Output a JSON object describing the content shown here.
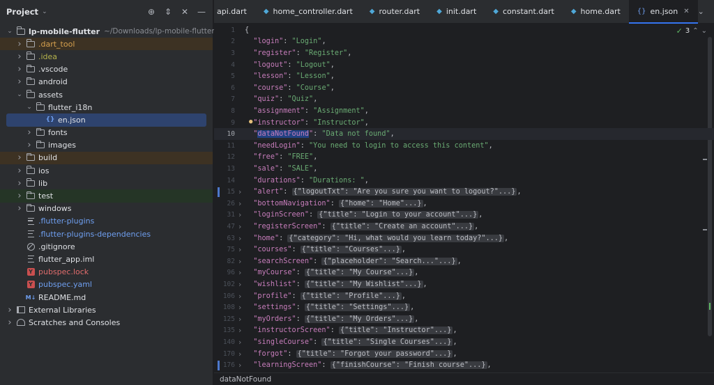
{
  "project_panel": {
    "title": "Project",
    "tree": [
      {
        "label": "lp-mobile-flutter",
        "path": "~/Downloads/lp-mobile-flutter",
        "indent": 0,
        "arrow": "open",
        "icon": "folder",
        "style": "bold"
      },
      {
        "label": ".dart_tool",
        "indent": 1,
        "arrow": "closed",
        "icon": "folder",
        "style": "orange",
        "hl": "excluded"
      },
      {
        "label": ".idea",
        "indent": 1,
        "arrow": "closed",
        "icon": "folder",
        "style": "yellow-green"
      },
      {
        "label": ".vscode",
        "indent": 1,
        "arrow": "closed",
        "icon": "folder",
        "style": ""
      },
      {
        "label": "android",
        "indent": 1,
        "arrow": "closed",
        "icon": "folder",
        "style": ""
      },
      {
        "label": "assets",
        "indent": 1,
        "arrow": "open",
        "icon": "folder",
        "style": ""
      },
      {
        "label": "flutter_i18n",
        "indent": 2,
        "arrow": "open",
        "icon": "folder",
        "style": ""
      },
      {
        "label": "en.json",
        "indent": 3,
        "arrow": "none",
        "icon": "json",
        "style": "",
        "selected": true
      },
      {
        "label": "fonts",
        "indent": 2,
        "arrow": "closed",
        "icon": "folder",
        "style": ""
      },
      {
        "label": "images",
        "indent": 2,
        "arrow": "closed",
        "icon": "folder",
        "style": ""
      },
      {
        "label": "build",
        "indent": 1,
        "arrow": "closed",
        "icon": "folder",
        "style": "",
        "hl": "excluded"
      },
      {
        "label": "ios",
        "indent": 1,
        "arrow": "closed",
        "icon": "folder",
        "style": ""
      },
      {
        "label": "lib",
        "indent": 1,
        "arrow": "closed",
        "icon": "folder",
        "style": ""
      },
      {
        "label": "test",
        "indent": 1,
        "arrow": "closed",
        "icon": "folder",
        "style": "",
        "hl": "test"
      },
      {
        "label": "windows",
        "indent": 1,
        "arrow": "closed",
        "icon": "folder",
        "style": ""
      },
      {
        "label": ".flutter-plugins",
        "indent": 1,
        "arrow": "none",
        "icon": "lines",
        "style": "blue"
      },
      {
        "label": ".flutter-plugins-dependencies",
        "indent": 1,
        "arrow": "none",
        "icon": "lines",
        "style": "blue"
      },
      {
        "label": ".gitignore",
        "indent": 1,
        "arrow": "none",
        "icon": "ban",
        "style": ""
      },
      {
        "label": "flutter_app.iml",
        "indent": 1,
        "arrow": "none",
        "icon": "lines",
        "style": ""
      },
      {
        "label": "pubspec.lock",
        "indent": 1,
        "arrow": "none",
        "icon": "yml",
        "style": "red"
      },
      {
        "label": "pubspec.yaml",
        "indent": 1,
        "arrow": "none",
        "icon": "yml",
        "style": "blue"
      },
      {
        "label": "README.md",
        "indent": 1,
        "arrow": "none",
        "icon": "md",
        "style": ""
      },
      {
        "label": "External Libraries",
        "indent": 0,
        "arrow": "closed",
        "icon": "lib",
        "style": ""
      },
      {
        "label": "Scratches and Consoles",
        "indent": 0,
        "arrow": "closed",
        "icon": "scratch",
        "style": ""
      }
    ]
  },
  "tabs": [
    {
      "label": "api.dart",
      "active": false
    },
    {
      "label": "home_controller.dart",
      "active": false
    },
    {
      "label": "router.dart",
      "active": false
    },
    {
      "label": "init.dart",
      "active": false
    },
    {
      "label": "constant.dart",
      "active": false
    },
    {
      "label": "home.dart",
      "active": false
    },
    {
      "label": "en.json",
      "active": true
    }
  ],
  "inspection": {
    "count": "3"
  },
  "editor": {
    "current_line": "10",
    "lines": [
      {
        "n": "1",
        "type": "brace",
        "text": "{"
      },
      {
        "n": "2",
        "type": "kv",
        "key": "\"login\"",
        "value": "\"Login\""
      },
      {
        "n": "3",
        "type": "kv",
        "key": "\"register\"",
        "value": "\"Register\""
      },
      {
        "n": "4",
        "type": "kv",
        "key": "\"logout\"",
        "value": "\"Logout\""
      },
      {
        "n": "5",
        "type": "kv",
        "key": "\"lesson\"",
        "value": "\"Lesson\""
      },
      {
        "n": "6",
        "type": "kv",
        "key": "\"course\"",
        "value": "\"Course\""
      },
      {
        "n": "7",
        "type": "kv",
        "key": "\"quiz\"",
        "value": "\"Quiz\""
      },
      {
        "n": "8",
        "type": "kv",
        "key": "\"assignment\"",
        "value": "\"Assignment\""
      },
      {
        "n": "9",
        "type": "kv",
        "key": "\"instructor\"",
        "value": "\"Instructor\""
      },
      {
        "n": "10",
        "type": "kvsel",
        "key": "dataNotFound",
        "value": "\"Data not found\""
      },
      {
        "n": "11",
        "type": "kv",
        "key": "\"needLogin\"",
        "value": "\"You need to login to access this content\""
      },
      {
        "n": "12",
        "type": "kv",
        "key": "\"free\"",
        "value": "\"FREE\""
      },
      {
        "n": "13",
        "type": "kv",
        "key": "\"sale\"",
        "value": "\"SALE\""
      },
      {
        "n": "14",
        "type": "kv",
        "key": "\"durations\"",
        "value": "\"Durations: \""
      },
      {
        "n": "15",
        "type": "fold",
        "key": "\"alert\"",
        "folded": "{\"logoutTxt\": \"Are you sure you want to logout?\"...}",
        "mark": true
      },
      {
        "n": "26",
        "type": "fold",
        "key": "\"bottomNavigation\"",
        "folded": "{\"home\": \"Home\"...}"
      },
      {
        "n": "31",
        "type": "fold",
        "key": "\"loginScreen\"",
        "folded": "{\"title\": \"Login to your account\"...}"
      },
      {
        "n": "47",
        "type": "fold",
        "key": "\"registerScreen\"",
        "folded": "{\"title\": \"Create an account\"...}"
      },
      {
        "n": "63",
        "type": "fold",
        "key": "\"home\"",
        "folded": "{\"category\": \"Hi, what would you learn today?\"...}"
      },
      {
        "n": "75",
        "type": "fold",
        "key": "\"courses\"",
        "folded": "{\"title\": \"Courses\"...}"
      },
      {
        "n": "82",
        "type": "fold",
        "key": "\"searchScreen\"",
        "folded": "{\"placeholder\": \"Search...\"...}"
      },
      {
        "n": "96",
        "type": "fold",
        "key": "\"myCourse\"",
        "folded": "{\"title\": \"My Course\"...}"
      },
      {
        "n": "102",
        "type": "fold",
        "key": "\"wishlist\"",
        "folded": "{\"title\": \"My Wishlist\"...}"
      },
      {
        "n": "106",
        "type": "fold",
        "key": "\"profile\"",
        "folded": "{\"title\": \"Profile\"...}"
      },
      {
        "n": "108",
        "type": "fold",
        "key": "\"settings\"",
        "folded": "{\"title\": \"Settings\"...}"
      },
      {
        "n": "125",
        "type": "fold",
        "key": "\"myOrders\"",
        "folded": "{\"title\": \"My Orders\"...}"
      },
      {
        "n": "135",
        "type": "fold",
        "key": "\"instructorScreen\"",
        "folded": "{\"title\": \"Instructor\"...}"
      },
      {
        "n": "140",
        "type": "fold",
        "key": "\"singleCourse\"",
        "folded": "{\"title\": \"Single Courses\"...}"
      },
      {
        "n": "170",
        "type": "fold",
        "key": "\"forgot\"",
        "folded": "{\"title\": \"Forgot your password\"...}"
      },
      {
        "n": "176",
        "type": "fold",
        "key": "\"learningScreen\"",
        "folded": "{\"finishCourse\": \"Finish course\"...}",
        "mark": true
      }
    ]
  },
  "statusbar": {
    "breadcrumb": "dataNotFound"
  }
}
